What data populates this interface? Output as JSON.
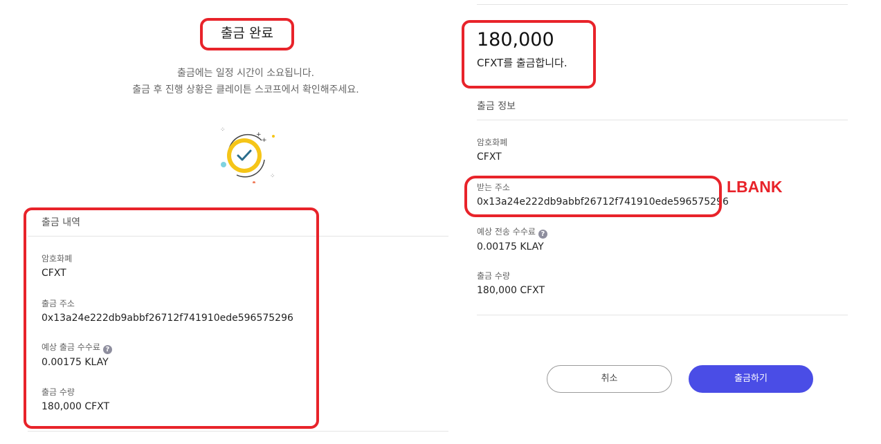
{
  "left": {
    "title": "출금 완료",
    "description_line1": "출금에는 일정 시간이 소요됩니다.",
    "description_line2": "출금 후 진행 상황은 클레이튼 스코프에서 확인해주세요.",
    "history": {
      "section_title": "출금 내역",
      "currency_label": "암호화폐",
      "currency_value": "CFXT",
      "address_label": "출금 주소",
      "address_value": "0x13a24e222db9abbf26712f741910ede596575296",
      "fee_label": "예상 출금 수수료",
      "fee_value": "0.00175 KLAY",
      "amount_label": "출금 수량",
      "amount_value": "180,000 CFXT"
    },
    "help_glyph": "?"
  },
  "right": {
    "amount": "180,000",
    "amount_sub": "CFXT를 출금합니다.",
    "info": {
      "section_title": "출금 정보",
      "currency_label": "암호화폐",
      "currency_value": "CFXT",
      "address_label": "받는 주소",
      "address_value": "0x13a24e222db9abbf26712f741910ede596575296",
      "fee_label": "예상 전송 수수료",
      "fee_value": "0.00175 KLAY",
      "amount_label": "출금 수량",
      "amount_value": "180,000 CFXT"
    },
    "exchange_annotation": "LBANK",
    "cancel_label": "취소",
    "withdraw_label": "출금하기",
    "help_glyph": "?"
  },
  "colors": {
    "accent": "#4a4de6",
    "annotation_red": "#e8232a",
    "check_yellow": "#f5c518"
  },
  "icons": {
    "success": "check-circle-icon",
    "help": "question-circle-icon"
  }
}
